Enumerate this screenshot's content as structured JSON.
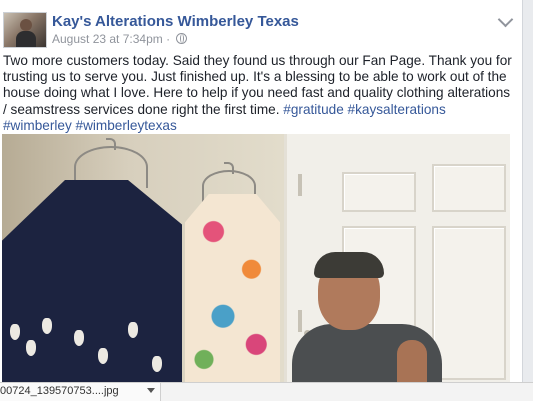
{
  "post": {
    "page_name": "Kay's Alterations Wimberley Texas",
    "timestamp": "August 23 at 7:34pm",
    "separator": " · ",
    "body_text": "Two more customers today. Said they found us through our Fan Page. Thank you for trusting us to serve you. Just finished up. It's a blessing to be able to work out of the house doing what I love. Here to help if you need fast and quality clothing alterations / seamstress services done right the first time.",
    "hashtags": [
      "#gratitude",
      "#kaysalterations",
      "#wimberley",
      "#wimberleytexas"
    ],
    "privacy_icon": "globe-icon",
    "menu_icon": "chevron-down-icon"
  },
  "download_bar": {
    "file_name": "00724_139570753....jpg",
    "menu_icon": "chevron-down-icon"
  },
  "colors": {
    "link": "#365899",
    "text": "#1d2129",
    "meta": "#90949c",
    "background": "#e9ebee"
  }
}
